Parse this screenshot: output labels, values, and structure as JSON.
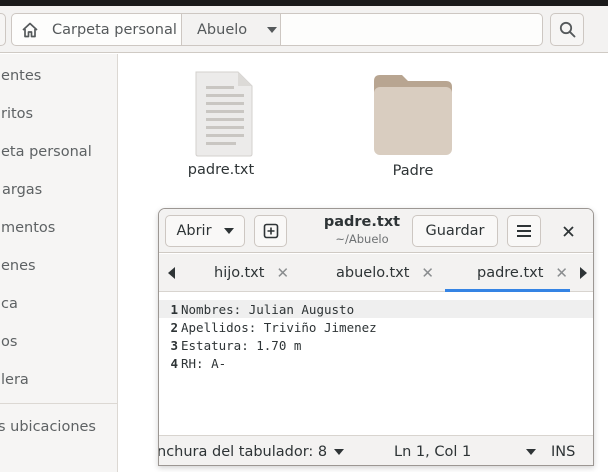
{
  "files_window": {
    "path": {
      "home_label": "Carpeta personal",
      "current_label": "Abuelo"
    },
    "sidebar": {
      "items": [
        {
          "label": "ientes"
        },
        {
          "label": "ritos"
        },
        {
          "label": "eta personal"
        },
        {
          "label": "argas"
        },
        {
          "label": "mentos"
        },
        {
          "label": "enes"
        },
        {
          "label": "ca"
        },
        {
          "label": "os"
        },
        {
          "label": "lera"
        }
      ],
      "other_locations": "s ubicaciones"
    },
    "files": [
      {
        "name": "padre.txt",
        "kind": "text-file"
      },
      {
        "name": "Padre",
        "kind": "folder"
      }
    ]
  },
  "gedit": {
    "open_label": "Abrir",
    "title": "padre.txt",
    "subtitle": "~/Abuelo",
    "save_label": "Guardar",
    "tabs": [
      {
        "label": "hijo.txt",
        "active": false
      },
      {
        "label": "abuelo.txt",
        "active": false
      },
      {
        "label": "padre.txt",
        "active": true
      }
    ],
    "lines": [
      {
        "num": "1",
        "text": "Nombres: Julian Augusto"
      },
      {
        "num": "2",
        "text": "Apellidos: Triviño Jimenez"
      },
      {
        "num": "3",
        "text": "Estatura: 1.70 m"
      },
      {
        "num": "4",
        "text": "RH: A-"
      }
    ],
    "status": {
      "tab_width": "nchura del tabulador: 8",
      "position": "Ln 1, Col 1",
      "mode": "INS"
    }
  },
  "colors": {
    "accent": "#3584e4",
    "headerbar": "#f3f2f1",
    "sidebar": "#f6f5f4",
    "folder": "#cdbba9"
  }
}
